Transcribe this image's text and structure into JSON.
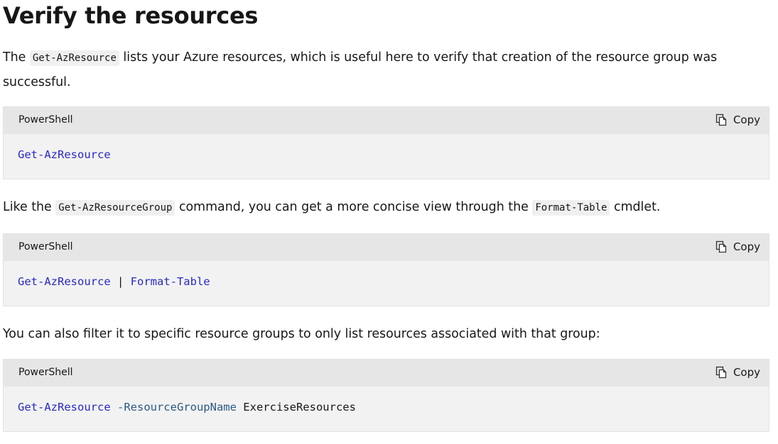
{
  "heading": "Verify the resources",
  "para1": {
    "before": "The ",
    "code": "Get-AzResource",
    "after": " lists your Azure resources, which is useful here to verify that creation of the resource group was",
    "line2": "successful."
  },
  "para2": {
    "before": "Like the ",
    "code1": "Get-AzResourceGroup",
    "middle": " command, you can get a more concise view through the ",
    "code2": "Format-Table",
    "after": " cmdlet."
  },
  "para3": "You can also filter it to specific resource groups to only list resources associated with that group:",
  "blocks": [
    {
      "language": "PowerShell",
      "copy_label": "Copy",
      "cmd": "Get-AzResource"
    },
    {
      "language": "PowerShell",
      "copy_label": "Copy",
      "cmd": "Get-AzResource",
      "pipe": " | ",
      "cmd2": "Format-Table"
    },
    {
      "language": "PowerShell",
      "copy_label": "Copy",
      "cmd": "Get-AzResource",
      "param": " -ResourceGroupName",
      "arg": " ExerciseResources"
    }
  ],
  "icons": {
    "copy": "copy-icon"
  }
}
